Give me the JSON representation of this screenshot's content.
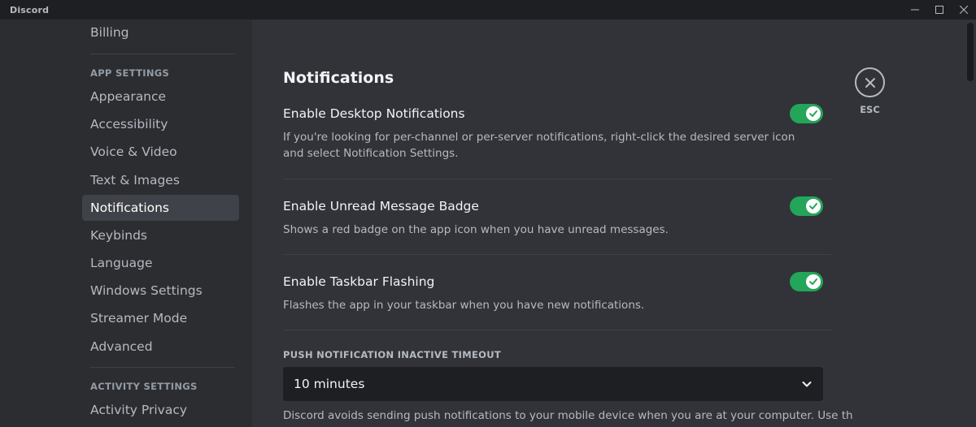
{
  "window": {
    "title": "Discord"
  },
  "sidebar": {
    "top_item": "Billing",
    "app_settings_header": "APP SETTINGS",
    "items": [
      {
        "label": "Appearance"
      },
      {
        "label": "Accessibility"
      },
      {
        "label": "Voice & Video"
      },
      {
        "label": "Text & Images"
      },
      {
        "label": "Notifications",
        "selected": true
      },
      {
        "label": "Keybinds"
      },
      {
        "label": "Language"
      },
      {
        "label": "Windows Settings"
      },
      {
        "label": "Streamer Mode"
      },
      {
        "label": "Advanced"
      }
    ],
    "activity_settings_header": "ACTIVITY SETTINGS",
    "activity_items": [
      {
        "label": "Activity Privacy"
      }
    ]
  },
  "main": {
    "title": "Notifications",
    "settings": [
      {
        "title": "Enable Desktop Notifications",
        "description": "If you're looking for per-channel or per-server notifications, right-click the desired server icon and select Notification Settings.",
        "enabled": true
      },
      {
        "title": "Enable Unread Message Badge",
        "description": "Shows a red badge on the app icon when you have unread messages.",
        "enabled": true
      },
      {
        "title": "Enable Taskbar Flashing",
        "description": "Flashes the app in your taskbar when you have new notifications.",
        "enabled": true
      }
    ],
    "timeout": {
      "label": "PUSH NOTIFICATION INACTIVE TIMEOUT",
      "value": "10 minutes",
      "description": "Discord avoids sending push notifications to your mobile device when you are at your computer. Use this setting"
    }
  },
  "close": {
    "label": "ESC",
    "icon": "close-icon"
  },
  "colors": {
    "toggle_on": "#23a55a",
    "sidebar_bg": "#2b2d31",
    "main_bg": "#313338",
    "titlebar_bg": "#1e1f22",
    "selected_item_bg": "#404249"
  }
}
